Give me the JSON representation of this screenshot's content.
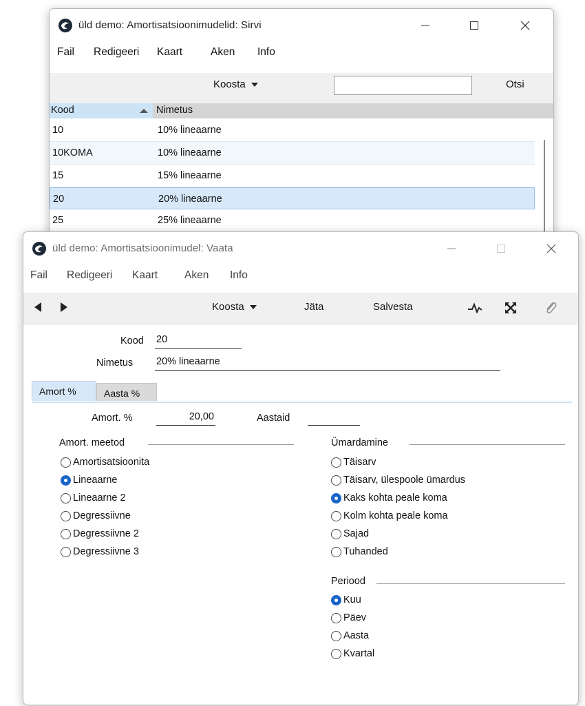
{
  "browse_window": {
    "title": "üld demo: Amortisatsioonimudelid: Sirvi",
    "menu": [
      "Fail",
      "Redigeeri",
      "Kaart",
      "Aken",
      "Info"
    ],
    "koosta_label": "Koosta",
    "search_value": "",
    "search_button": "Otsi",
    "columns": [
      "Kood",
      "Nimetus"
    ],
    "rows": [
      {
        "kood": "10",
        "nimetus": "10% lineaarne"
      },
      {
        "kood": "10KOMA",
        "nimetus": "10% lineaarne"
      },
      {
        "kood": "15",
        "nimetus": "15% lineaarne"
      },
      {
        "kood": "20",
        "nimetus": "20% lineaarne"
      },
      {
        "kood": "25",
        "nimetus": "25% lineaarne"
      }
    ],
    "selected_row": "20"
  },
  "record_window": {
    "title": "üld demo: Amortisatsioonimudel: Vaata",
    "menu": [
      "Fail",
      "Redigeeri",
      "Kaart",
      "Aken",
      "Info"
    ],
    "toolbar": {
      "koosta": "Koosta",
      "jata": "Jäta",
      "salvesta": "Salvesta"
    },
    "kood_label": "Kood",
    "kood_value": "20",
    "nimetus_label": "Nimetus",
    "nimetus_value": "20% lineaarne",
    "tabs": [
      "Amort %",
      "Aasta %"
    ],
    "active_tab": "Amort %",
    "amort_label": "Amort. %",
    "amort_value": "20,00",
    "aastaid_label": "Aastaid",
    "aastaid_value": "",
    "meetod": {
      "label": "Amort. meetod",
      "options": [
        "Amortisatsioonita",
        "Lineaarne",
        "Lineaarne 2",
        "Degressiivne",
        "Degressiivne 2",
        "Degressiivne 3"
      ],
      "selected": "Lineaarne"
    },
    "umardamine": {
      "label": "Ümardamine",
      "options": [
        "Täisarv",
        "Täisarv, ülespoole ümardus",
        "Kaks kohta peale koma",
        "Kolm kohta peale koma",
        "Sajad",
        "Tuhanded"
      ],
      "selected": "Kaks kohta peale koma"
    },
    "periood": {
      "label": "Periood",
      "options": [
        "Kuu",
        "Päev",
        "Aasta",
        "Kvartal"
      ],
      "selected": "Kuu"
    }
  },
  "colors": {
    "radio_selected": "#1a64c8",
    "selected_row_bg": "#d7e8fa",
    "sort_header_bg": "#cde4f7",
    "active_tab_bg": "#d6e8f8"
  }
}
